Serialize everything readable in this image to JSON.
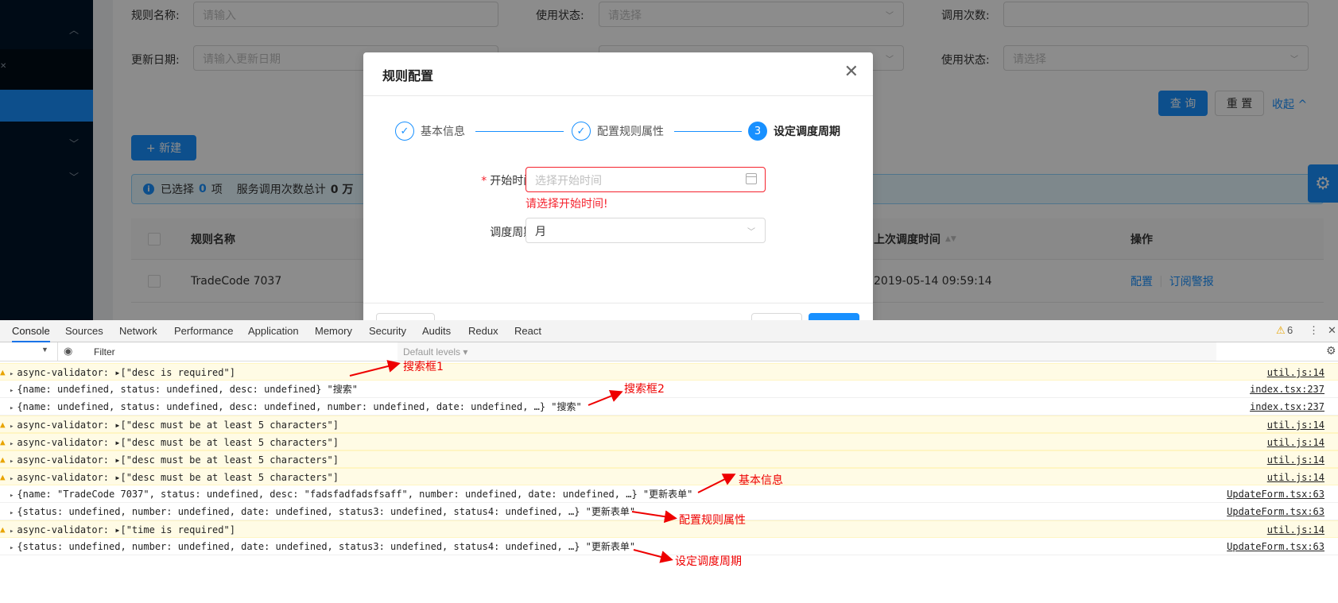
{
  "form": {
    "rule_name_label": "规则名称:",
    "rule_name_placeholder": "请输入",
    "status_label": "使用状态:",
    "status_placeholder": "请选择",
    "calls_label": "调用次数:",
    "update_date_label": "更新日期:",
    "update_date_placeholder": "请输入更新日期",
    "status2_label": "使用状态:",
    "status2_placeholder": "请选择",
    "query_button": "查 询",
    "reset_button": "重 置",
    "collapse_link": "收起 ^"
  },
  "toolbar": {
    "new_button": "+ 新建"
  },
  "alert": {
    "text1": "已选择",
    "count": "0",
    "text2": "项",
    "text3": "服务调用次数总计",
    "total": "0 万"
  },
  "table": {
    "headers": [
      "规则名称",
      "上次调度时间",
      "操作"
    ],
    "rows": [
      {
        "name": "TradeCode 7037",
        "time": "2019-05-14 09:59:14",
        "action1": "配置",
        "action2": "订阅警报"
      }
    ]
  },
  "modal": {
    "title": "规则配置",
    "steps": [
      {
        "label": "基本信息",
        "state": "done"
      },
      {
        "label": "配置规则属性",
        "state": "done"
      },
      {
        "label": "设定调度周期",
        "state": "current",
        "num": "3"
      }
    ],
    "start_time_label": "开始时间:",
    "start_time_placeholder": "选择开始时间",
    "start_time_error": "请选择开始时间!",
    "period_label": "调度周期:",
    "period_value": "月"
  },
  "devtools": {
    "tabs": [
      "Console",
      "Sources",
      "Network",
      "Performance",
      "Application",
      "Memory",
      "Security",
      "Audits",
      "Redux",
      "React"
    ],
    "warn_count": "6",
    "filter_placeholder": "Filter",
    "levels": "Default levels ▾",
    "lines": [
      {
        "type": "warn",
        "text": "async-validator: ▸[\"desc is required\"]",
        "src": "util.js:14"
      },
      {
        "type": "plain",
        "text": "{name: undefined, status: undefined, desc: undefined} \"搜索\"",
        "src": "index.tsx:237"
      },
      {
        "type": "plain",
        "text": "{name: undefined, status: undefined, desc: undefined, number: undefined, date: undefined, …} \"搜索\"",
        "src": "index.tsx:237"
      },
      {
        "type": "warn",
        "text": "async-validator: ▸[\"desc must be at least 5 characters\"]",
        "src": "util.js:14"
      },
      {
        "type": "warn",
        "text": "async-validator: ▸[\"desc must be at least 5 characters\"]",
        "src": "util.js:14"
      },
      {
        "type": "warn",
        "text": "async-validator: ▸[\"desc must be at least 5 characters\"]",
        "src": "util.js:14"
      },
      {
        "type": "warn",
        "text": "async-validator: ▸[\"desc must be at least 5 characters\"]",
        "src": "util.js:14"
      },
      {
        "type": "plain",
        "text": "{name: \"TradeCode 7037\", status: undefined, desc: \"fadsfadfadsfsaff\", number: undefined, date: undefined, …} \"更新表单\"",
        "src": "UpdateForm.tsx:63"
      },
      {
        "type": "plain",
        "text": "{status: undefined, number: undefined, date: undefined, status3: undefined, status4: undefined, …} \"更新表单\"",
        "src": "UpdateForm.tsx:63"
      },
      {
        "type": "warn",
        "text": "async-validator: ▸[\"time is required\"]",
        "src": "util.js:14"
      },
      {
        "type": "plain",
        "text": "{status: undefined, number: undefined, date: undefined, status3: undefined, status4: undefined, …} \"更新表单\"",
        "src": "UpdateForm.tsx:63"
      }
    ]
  },
  "annotations": {
    "a1": "搜索框1",
    "a2": "搜索框2",
    "a3": "基本信息",
    "a4": "配置规则属性",
    "a5": "设定调度周期"
  },
  "colors": {
    "primary": "#1890ff",
    "error": "#f5222d",
    "annotation": "#ee0000",
    "sidebar": "#001529"
  }
}
